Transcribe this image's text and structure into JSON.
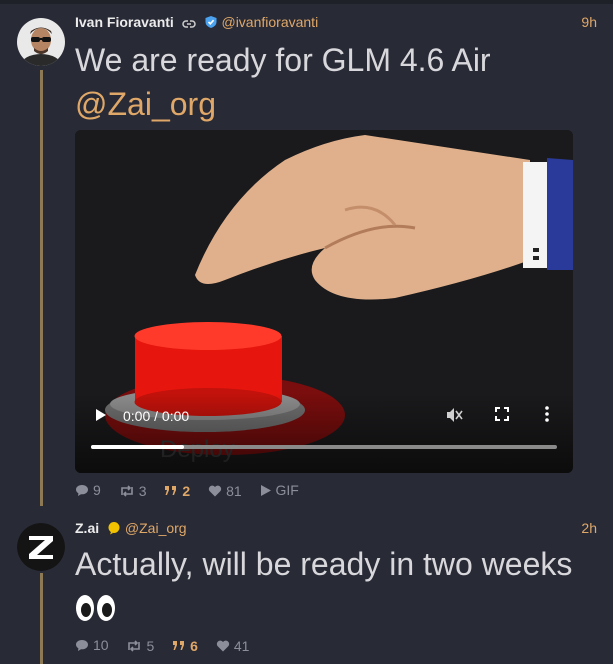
{
  "posts": [
    {
      "author_name": "Ivan Fioravanti",
      "handle": "@ivanfioravanti",
      "time": "9h",
      "text": "We are ready for GLM 4.6 Air",
      "mention": "@Zai_org",
      "video": {
        "timecode": "0:00 / 0:00",
        "progress": 0.2
      },
      "stats": {
        "replies": "9",
        "reposts": "3",
        "quotes": "2",
        "likes": "81",
        "gif_label": "GIF"
      }
    },
    {
      "author_name": "Z.ai",
      "handle": "@Zai_org",
      "time": "2h",
      "text": "Actually, will be ready in two weeks",
      "stats": {
        "replies": "10",
        "reposts": "5",
        "quotes": "6",
        "likes": "41"
      }
    }
  ],
  "colors": {
    "background": "#282a36",
    "accent": "#e0a868",
    "thread_line": "#8d7a55",
    "muted": "#8c8f99",
    "text": "#d8d8dc"
  }
}
